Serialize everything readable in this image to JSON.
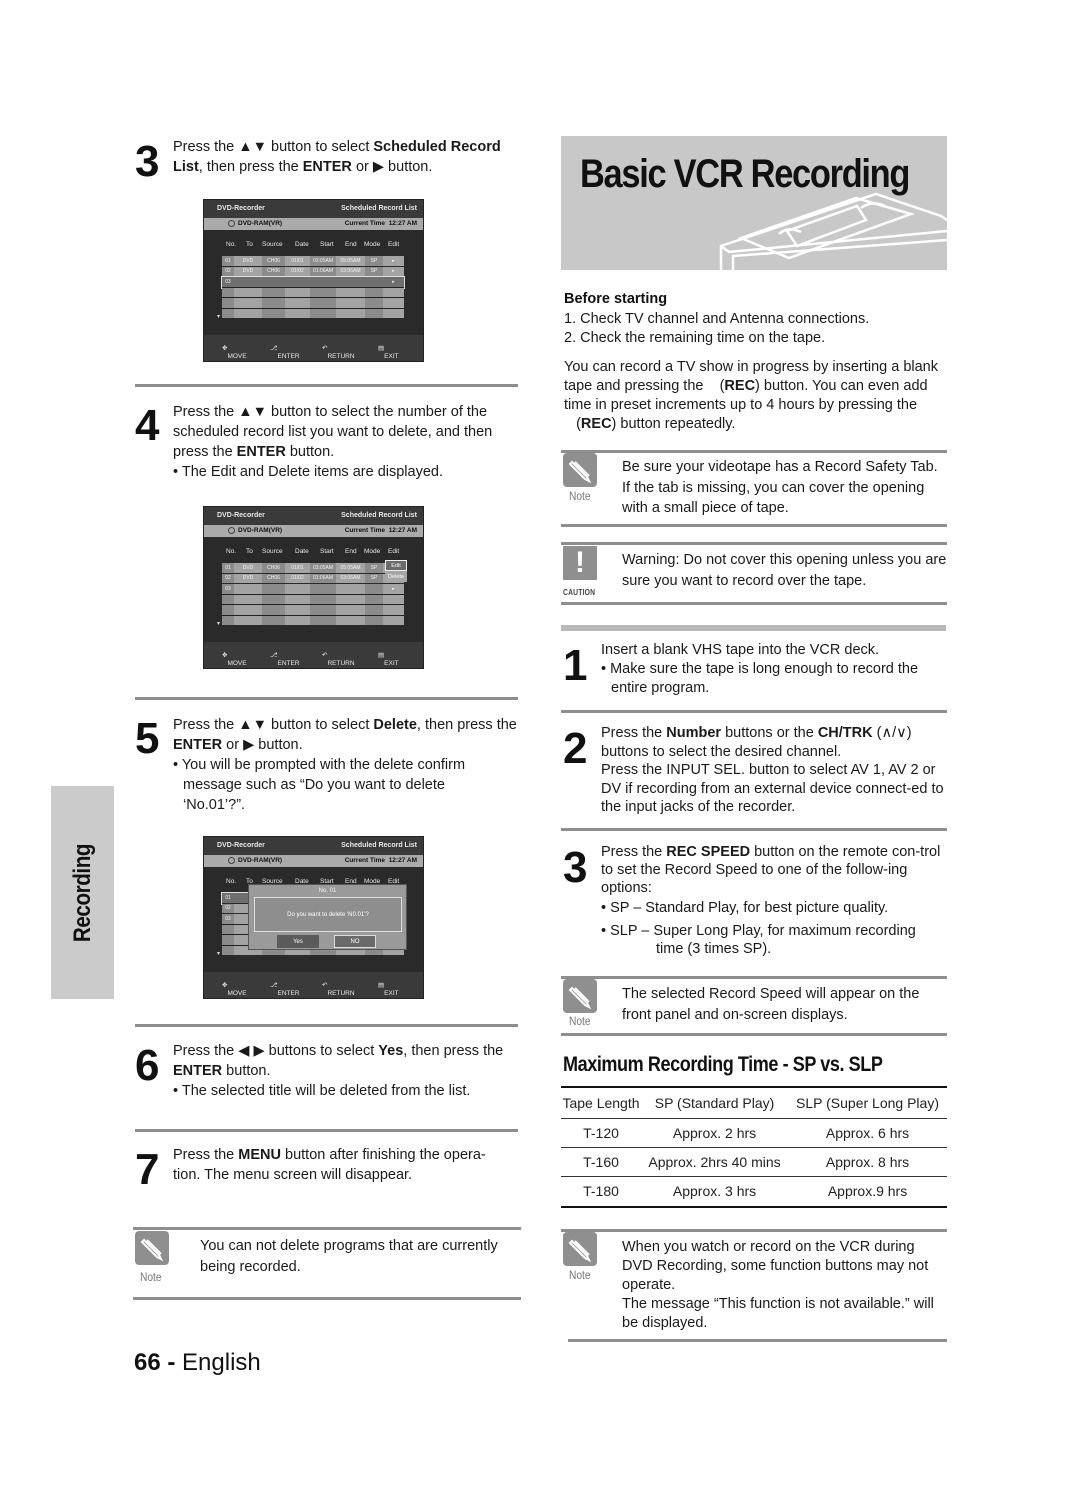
{
  "page": {
    "number": "66",
    "separator": " - ",
    "language": "English",
    "side_tab": "Recording"
  },
  "osd_common": {
    "app": "DVD-Recorder",
    "screen": "Scheduled Record List",
    "disc": "DVD-RAM(VR)",
    "current_time_label": "Current Time",
    "current_time": "12:27 AM",
    "columns": [
      "No.",
      "To",
      "Source",
      "Date",
      "Start",
      "End",
      "Mode",
      "Edit"
    ],
    "rows": [
      [
        "01",
        "DVD",
        "CH06",
        "01/01",
        "03:05AM",
        "05:05AM",
        "SP",
        "▸"
      ],
      [
        "02",
        "DVD",
        "CH06",
        "01/02",
        "01:06AM",
        "03:06AM",
        "SP",
        "▸"
      ],
      [
        "03",
        "",
        "",
        "",
        "",
        "",
        "",
        "▸"
      ]
    ],
    "footer": {
      "move": "MOVE",
      "enter": "ENTER",
      "return": "RETURN",
      "exit": "EXIT"
    },
    "scroll_down": "▾"
  },
  "osd2_menu": {
    "edit": "Edit",
    "delete": "Delete"
  },
  "osd3_dialog": {
    "title": "No. 01",
    "message": "Do you want to delete ‘N0.01’?",
    "yes": "Yes",
    "no": "NO"
  },
  "left_steps": [
    {
      "num": "3",
      "p1": "Press the ",
      "arrows": "▲▼",
      "p2": " button to select ",
      "b1": "Scheduled Record List",
      "p3": ", then press the ",
      "b2": "ENTER",
      "p4": " or ",
      "arrow": "▶",
      "p5": " button."
    },
    {
      "num": "4",
      "p1": "Press the ",
      "arrows": "▲▼",
      "p2": " button to select the number of the scheduled record list you want to delete, and then press the ",
      "b1": "ENTER",
      "p3": " button.",
      "bullet": "• The Edit and Delete items are displayed."
    },
    {
      "num": "5",
      "p1": "Press the ",
      "arrows": "▲▼",
      "p2": "  button to select ",
      "b1": "Delete",
      "p3": ", then press the ",
      "b2": "ENTER",
      "p4": " or ",
      "arrow": "▶",
      "p5": " button.",
      "bullet": "• You will be prompted with the delete confirm message such as “Do you want to delete ‘No.01’?”."
    },
    {
      "num": "6",
      "p1": "Press the ",
      "arrows": "◀ ▶",
      "p2": " buttons to select ",
      "b1": "Yes",
      "p3": ", then press the ",
      "b2": "ENTER",
      "p4": " button.",
      "bullet": "• The selected title will be deleted from the list."
    },
    {
      "num": "7",
      "p1": "Press the ",
      "b1": "MENU",
      "p2": " button after finishing the opera-tion. The menu screen will disappear."
    }
  ],
  "left_note": {
    "label": "Note",
    "text": "You can not delete programs that are currently being recorded."
  },
  "right": {
    "title": "Basic VCR Recording",
    "before_starting": {
      "heading": "Before starting",
      "items": [
        "1. Check TV channel and Antenna connections.",
        "2. Check the remaining time on the tape."
      ]
    },
    "intro": {
      "p1": "You can record a TV show in progress by inserting a blank tape and pressing the ",
      "rec1": "REC",
      "p2": " button. You can even add time in preset increments up to 4 hours by pressing the ",
      "rec2": "REC",
      "p3": " button repeatedly."
    },
    "note1": {
      "label": "Note",
      "text": "Be sure your videotape has a Record Safety Tab. If the tab is missing, you can cover the opening with a small piece of tape."
    },
    "caution": {
      "label": "CAUTION",
      "icon": "!",
      "text": "Warning: Do not cover this opening unless you are sure you want to record over the tape."
    },
    "steps": [
      {
        "num": "1",
        "text": "Insert a blank VHS tape into the VCR deck.",
        "bullet": "• Make sure the tape is long enough to record the entire program."
      },
      {
        "num": "2",
        "p1": "Press the ",
        "b1": "Number",
        "p2": " buttons or the ",
        "b2": "CH/TRK",
        "p3": " (∧/∨) buttons to select the desired channel.",
        "p4": "Press the INPUT SEL. button to select AV 1, AV 2 or DV if recording from an external device connect-ed to the input jacks of the recorder."
      },
      {
        "num": "3",
        "p1": "Press the ",
        "b1": "REC SPEED",
        "p2": " button on the remote con-trol to set the Record Speed to one of the follow-ing options:",
        "bullet1": "• SP – Standard Play, for best picture quality.",
        "bullet2a": "• SLP – Super Long Play, for maximum recording",
        "bullet2b": "time (3 times SP)."
      }
    ],
    "note2": {
      "label": "Note",
      "text": "The selected Record Speed will appear on the front panel and on-screen displays."
    },
    "table_title": "Maximum Recording Time - SP vs. SLP",
    "table": {
      "headers": [
        "Tape Length",
        "SP (Standard Play)",
        "SLP (Super Long Play)"
      ],
      "rows": [
        [
          "T-120",
          "Approx. 2 hrs",
          "Approx. 6 hrs"
        ],
        [
          "T-160",
          "Approx. 2hrs 40 mins",
          "Approx. 8 hrs"
        ],
        [
          "T-180",
          "Approx. 3 hrs",
          "Approx.9 hrs"
        ]
      ]
    },
    "note3": {
      "label": "Note",
      "text1": "When you watch or record on the VCR during DVD Recording, some function buttons may not operate.",
      "text2": "The message “This function is not available.” will be displayed."
    }
  }
}
